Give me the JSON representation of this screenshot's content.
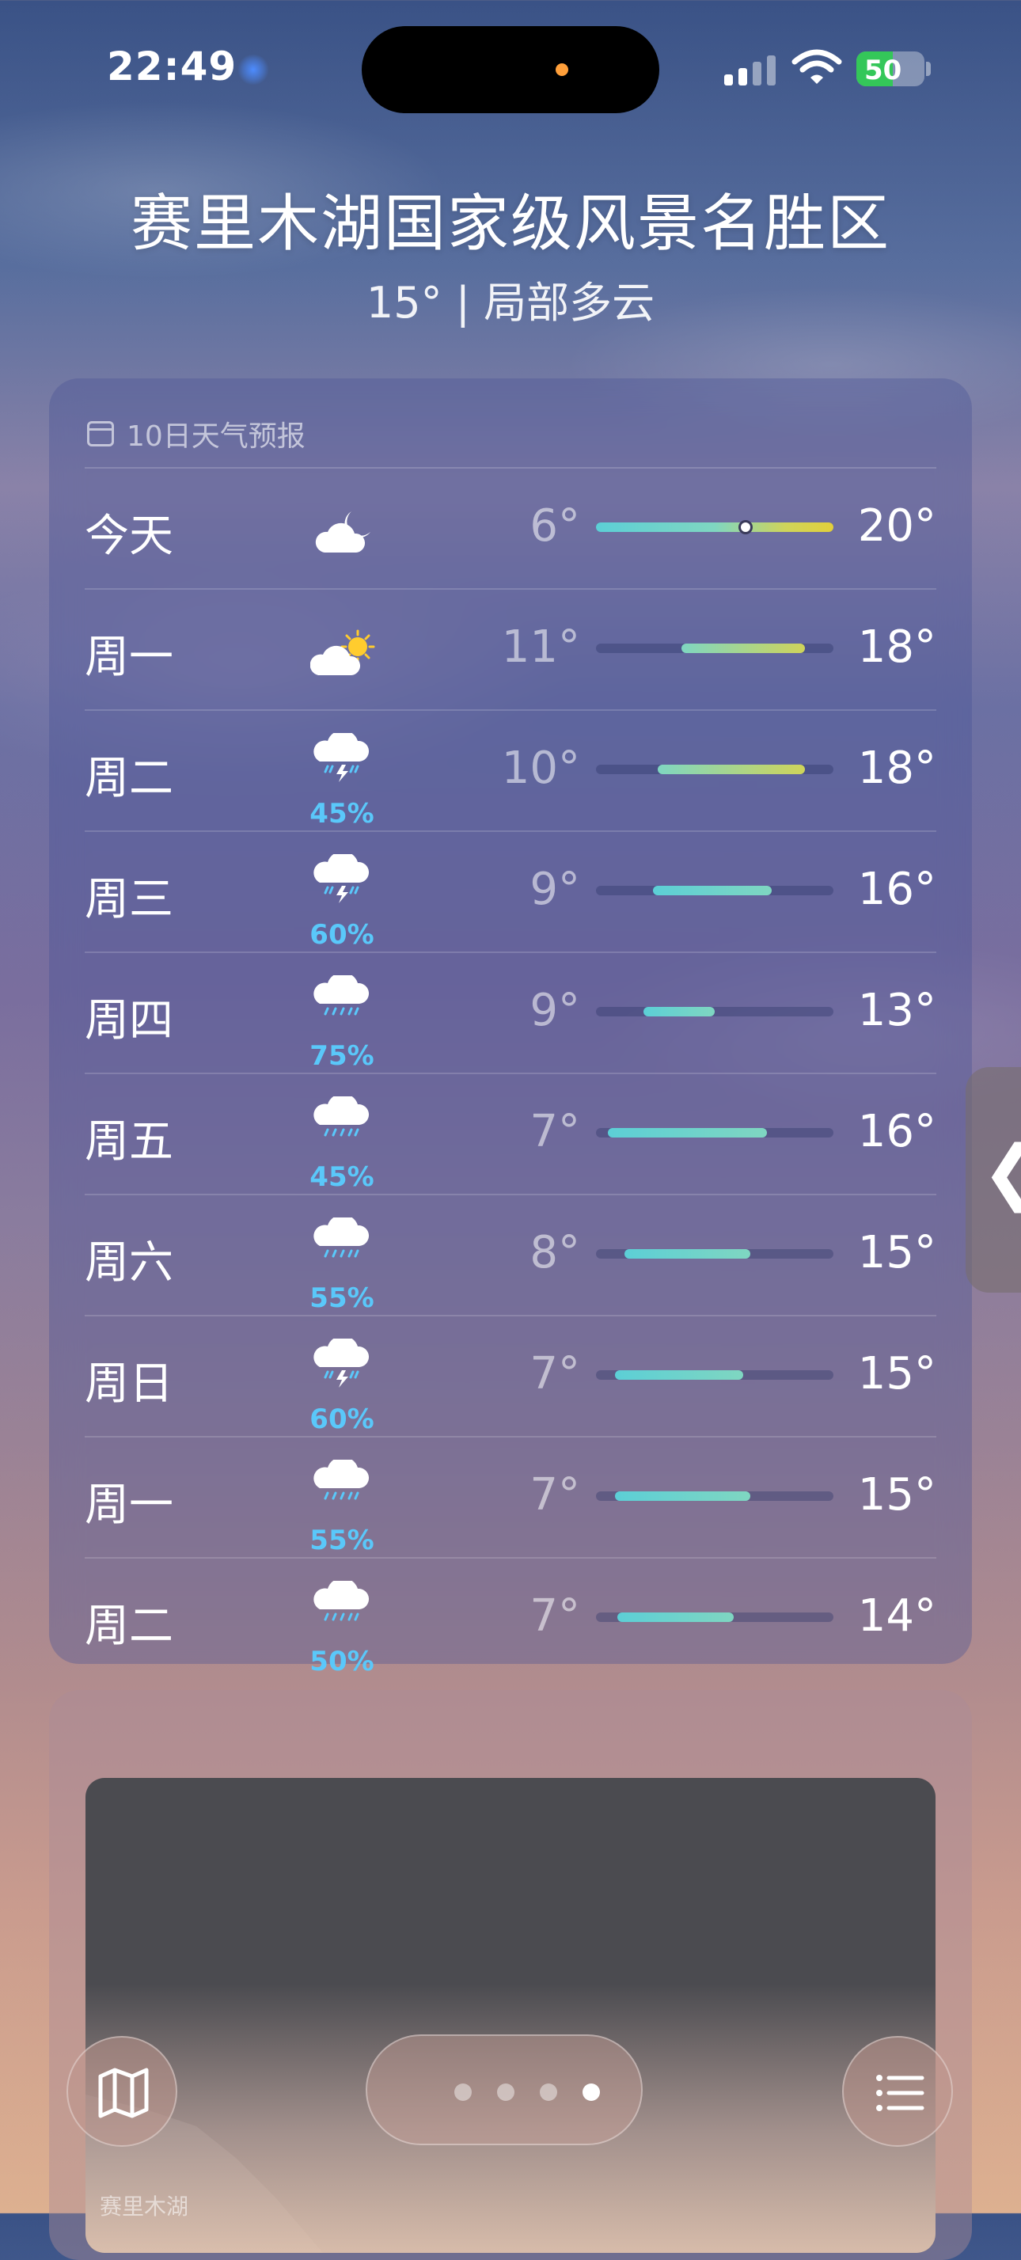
{
  "status_bar": {
    "time": "22:49",
    "battery": "50"
  },
  "header": {
    "location": "赛里木湖国家级风景名胜区",
    "summary": "15° | 局部多云"
  },
  "forecast": {
    "title": "10日天气预报",
    "days": [
      {
        "day": "今天",
        "icon": "cloud-moon-icon",
        "prob": "",
        "low": "6°",
        "high": "20°",
        "range": [
          0.0,
          1.0
        ],
        "now": 0.63
      },
      {
        "day": "周一",
        "icon": "cloud-sun-icon",
        "prob": "",
        "low": "11°",
        "high": "18°",
        "range": [
          0.36,
          0.88
        ]
      },
      {
        "day": "周二",
        "icon": "thunderstorm-icon",
        "prob": "45%",
        "low": "10°",
        "high": "18°",
        "range": [
          0.26,
          0.88
        ]
      },
      {
        "day": "周三",
        "icon": "thunderstorm-icon",
        "prob": "60%",
        "low": "9°",
        "high": "16°",
        "range": [
          0.24,
          0.74
        ]
      },
      {
        "day": "周四",
        "icon": "rain-icon",
        "prob": "75%",
        "low": "9°",
        "high": "13°",
        "range": [
          0.2,
          0.5
        ]
      },
      {
        "day": "周五",
        "icon": "rain-icon",
        "prob": "45%",
        "low": "7°",
        "high": "16°",
        "range": [
          0.05,
          0.72
        ]
      },
      {
        "day": "周六",
        "icon": "rain-icon",
        "prob": "55%",
        "low": "8°",
        "high": "15°",
        "range": [
          0.12,
          0.65
        ]
      },
      {
        "day": "周日",
        "icon": "thunderstorm-icon",
        "prob": "60%",
        "low": "7°",
        "high": "15°",
        "range": [
          0.08,
          0.62
        ]
      },
      {
        "day": "周一",
        "icon": "rain-icon",
        "prob": "55%",
        "low": "7°",
        "high": "15°",
        "range": [
          0.08,
          0.65
        ]
      },
      {
        "day": "周二",
        "icon": "rain-icon",
        "prob": "50%",
        "low": "7°",
        "high": "14°",
        "range": [
          0.09,
          0.58
        ]
      }
    ]
  },
  "map": {
    "label": "赛里木湖"
  },
  "toolbar": {
    "pages": 4,
    "active_page": 3
  },
  "colors": {
    "cool": "#5ccfd6",
    "mid": "#7fd6c1",
    "warm": "#cfd45a",
    "hot": "#e2d03a",
    "prob": "#5ac8fa"
  }
}
